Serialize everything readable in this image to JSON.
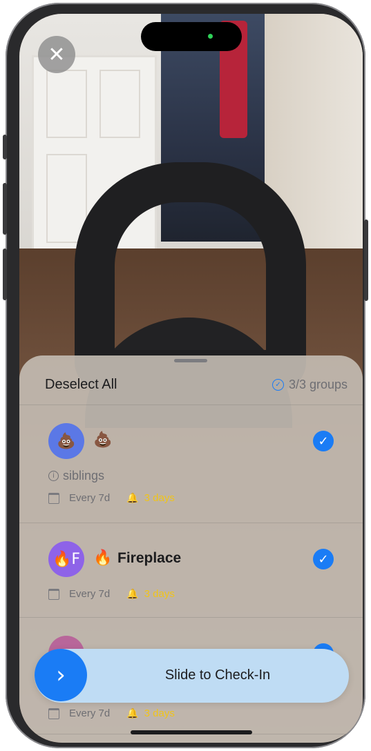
{
  "header": {
    "deselect_label": "Deselect All",
    "groups_count": "3/3 groups"
  },
  "groups": [
    {
      "avatar_text": "💩",
      "emoji": "💩",
      "name": "",
      "subtitle": "siblings",
      "frequency": "Every 7d",
      "reminder": "3 days",
      "avatar_color": "#5b78e6",
      "selected": true
    },
    {
      "avatar_text": "🔥F",
      "emoji": "🔥",
      "name": "Fireplace",
      "frequency": "Every 7d",
      "reminder": "3 days",
      "avatar_color": "#8e63e8",
      "selected": true
    },
    {
      "avatar_text": "",
      "emoji": "",
      "name": "",
      "frequency": "Every 7d",
      "reminder": "3 days",
      "avatar_color": "#b8669a",
      "selected": true
    }
  ],
  "slider": {
    "label": "Slide to Check-In"
  },
  "colors": {
    "accent": "#1a7cf5",
    "reminder": "#f0c419"
  }
}
